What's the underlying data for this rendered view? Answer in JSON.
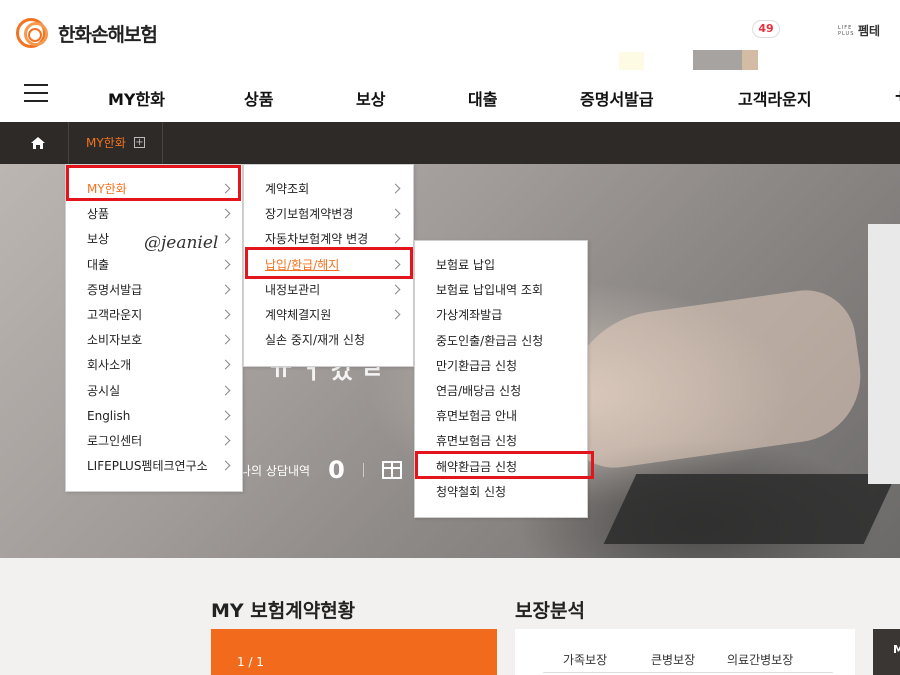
{
  "header": {
    "logo_text": "한화손해보험",
    "notification_count": "49",
    "lifeplus_mini": "LIFE PLUS",
    "lifeplus_label": "펨테"
  },
  "gnb": {
    "items": [
      "MY한화",
      "상품",
      "보상",
      "대출",
      "증명서발급",
      "고객라운지"
    ],
    "overflow_hint": "+"
  },
  "location": {
    "current": "MY한화",
    "plus": "+"
  },
  "menu1": {
    "items": [
      "MY한화",
      "상품",
      "보상",
      "대출",
      "증명서발급",
      "고객라운지",
      "소비자보호",
      "회사소개",
      "공시실",
      "English",
      "로그인센터",
      "LIFEPLUS펨테크연구소"
    ],
    "active": "MY한화"
  },
  "menu2": {
    "items": [
      "계약조회",
      "장기보험계약변경",
      "자동차보험계약 변경",
      "납입/환급/해지",
      "내정보관리",
      "계약체결지원",
      "실손 중지/재개 신청"
    ],
    "active": "납입/환급/해지"
  },
  "menu3": {
    "items": [
      "보험료 납입",
      "보험료 납입내역 조회",
      "가상계좌발급",
      "중도인출/환급금 신청",
      "만기환급금 신청",
      "연금/배당금 신청",
      "휴면보험금 안내",
      "휴면보험금 신청",
      "해약환급금 신청",
      "청약철회 신청"
    ],
    "highlighted": "해약환급금 신청"
  },
  "watermark": "@jeaniel",
  "hero": {
    "heading_fragment": "ㅠ ㅓ 갔 ㄹ",
    "consult_label": "나의 상담내역",
    "consult_count": "0"
  },
  "sections": {
    "contract_status_title": "MY 보험계약현황",
    "pager": "1 / 1",
    "coverage_title": "보장분석",
    "coverage_tabs": [
      "가족보장",
      "큰병보장",
      "의료간병보장"
    ],
    "dark_card_initial": "M"
  },
  "colors": {
    "brand_orange": "#f37321",
    "highlight_red": "#e3141c",
    "location_bar": "#2d2a28"
  }
}
